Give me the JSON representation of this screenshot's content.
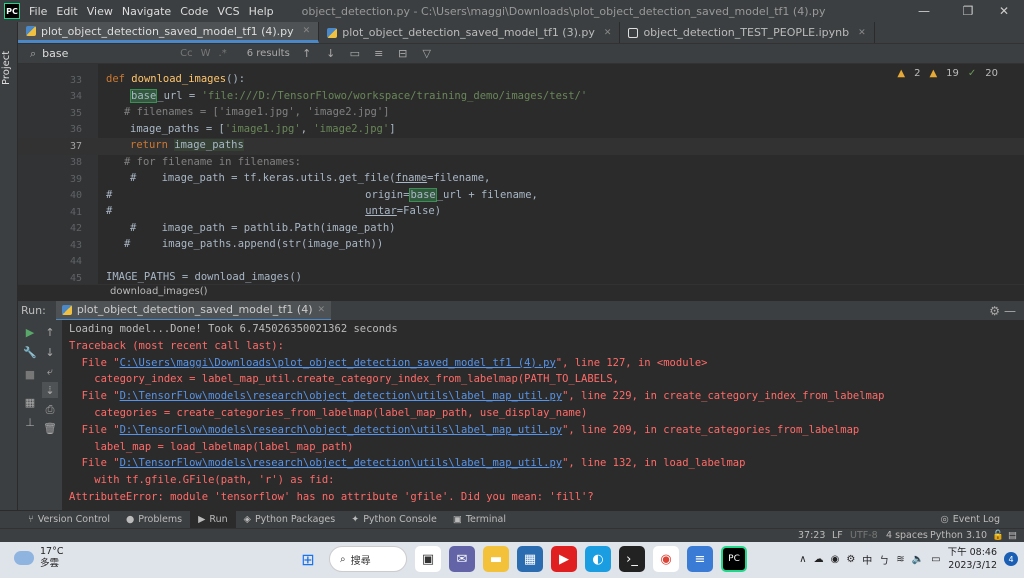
{
  "app": {
    "logo": "PC",
    "menu": [
      "File",
      "Edit",
      "View",
      "Navigate",
      "Code",
      "VCS",
      "Help"
    ],
    "window_title": "object_detection.py - C:\\Users\\maggi\\Downloads\\plot_object_detection_saved_model_tf1 (4).py",
    "controls": {
      "minimize": "—",
      "restore": "❐",
      "close": "✕"
    }
  },
  "sidebar": {
    "project_label": "Project"
  },
  "tabs": [
    {
      "label": "plot_object_detection_saved_model_tf1 (4).py",
      "active": true,
      "icon": "python-file-icon"
    },
    {
      "label": "plot_object_detection_saved_model_tf1 (3).py",
      "active": false,
      "icon": "python-file-icon"
    },
    {
      "label": "object_detection_TEST_PEOPLE.ipynb",
      "active": false,
      "icon": "notebook-file-icon"
    }
  ],
  "search": {
    "value": "base",
    "options": [
      "Cc",
      "W",
      ".*"
    ],
    "result_count": "6 results"
  },
  "editor": {
    "inspections": {
      "warnings": "2",
      "weak_warnings": "19",
      "ok": "20"
    },
    "line_numbers": [
      "33",
      "34",
      "35",
      "36",
      "37",
      "38",
      "39",
      "40",
      "41",
      "42",
      "43",
      "44",
      "45"
    ],
    "current_line": "37",
    "breadcrumb": "download_images()"
  },
  "run": {
    "label": "Run:",
    "tab": "plot_object_detection_saved_model_tf1 (4)",
    "console": [
      {
        "type": "out",
        "parts": [
          {
            "t": "Loading model...Done! Took 6.745026350021362 seconds"
          }
        ]
      },
      {
        "type": "err",
        "parts": [
          {
            "t": "Traceback (most recent call last):"
          }
        ]
      },
      {
        "type": "err",
        "parts": [
          {
            "t": "  File \""
          },
          {
            "t": "C:\\Users\\maggi\\Downloads\\plot_object_detection_saved_model_tf1 (4).py",
            "link": true
          },
          {
            "t": "\", line 127, in <module>"
          }
        ]
      },
      {
        "type": "err",
        "parts": [
          {
            "t": "    category_index = label_map_util.create_category_index_from_labelmap(PATH_TO_LABELS,"
          }
        ]
      },
      {
        "type": "err",
        "parts": [
          {
            "t": "  File \""
          },
          {
            "t": "D:\\TensorFlow\\models\\research\\object_detection\\utils\\label_map_util.py",
            "link": true
          },
          {
            "t": "\", line 229, in create_category_index_from_labelmap"
          }
        ]
      },
      {
        "type": "err",
        "parts": [
          {
            "t": "    categories = create_categories_from_labelmap(label_map_path, use_display_name)"
          }
        ]
      },
      {
        "type": "err",
        "parts": [
          {
            "t": "  File \""
          },
          {
            "t": "D:\\TensorFlow\\models\\research\\object_detection\\utils\\label_map_util.py",
            "link": true
          },
          {
            "t": "\", line 209, in create_categories_from_labelmap"
          }
        ]
      },
      {
        "type": "err",
        "parts": [
          {
            "t": "    label_map = load_labelmap(label_map_path)"
          }
        ]
      },
      {
        "type": "err",
        "parts": [
          {
            "t": "  File \""
          },
          {
            "t": "D:\\TensorFlow\\models\\research\\object_detection\\utils\\label_map_util.py",
            "link": true
          },
          {
            "t": "\", line 132, in load_labelmap"
          }
        ]
      },
      {
        "type": "err",
        "parts": [
          {
            "t": "    with tf.gfile.GFile(path, 'r') as fid:"
          }
        ]
      },
      {
        "type": "err",
        "parts": [
          {
            "t": "AttributeError: module 'tensorflow' has no attribute 'gfile'. Did you mean: 'fill'?"
          }
        ]
      }
    ]
  },
  "tool_windows": [
    {
      "label": "Version Control",
      "icon": "branch-icon",
      "active": false
    },
    {
      "label": "Problems",
      "icon": "problems-icon",
      "active": false
    },
    {
      "label": "Run",
      "icon": "run-icon",
      "active": true
    },
    {
      "label": "Python Packages",
      "icon": "packages-icon",
      "active": false
    },
    {
      "label": "Python Console",
      "icon": "console-icon",
      "active": false
    },
    {
      "label": "Terminal",
      "icon": "terminal-icon",
      "active": false
    }
  ],
  "event_log": "Event Log",
  "status": {
    "position": "37:23",
    "line_sep": "LF",
    "encoding": "UTF-8",
    "indent": "4 spaces",
    "interpreter": "Python 3.10"
  },
  "taskbar": {
    "weather_temp": "17°C",
    "weather_desc": "多雲",
    "search_label": "搜尋",
    "ime": "中",
    "time": "下午 08:46",
    "date": "2023/3/12",
    "notification_count": "4"
  },
  "colors": {
    "accent": "#4a88c7",
    "error": "#ff6b68",
    "link": "#5894e8",
    "bg": "#2b2b2b"
  }
}
